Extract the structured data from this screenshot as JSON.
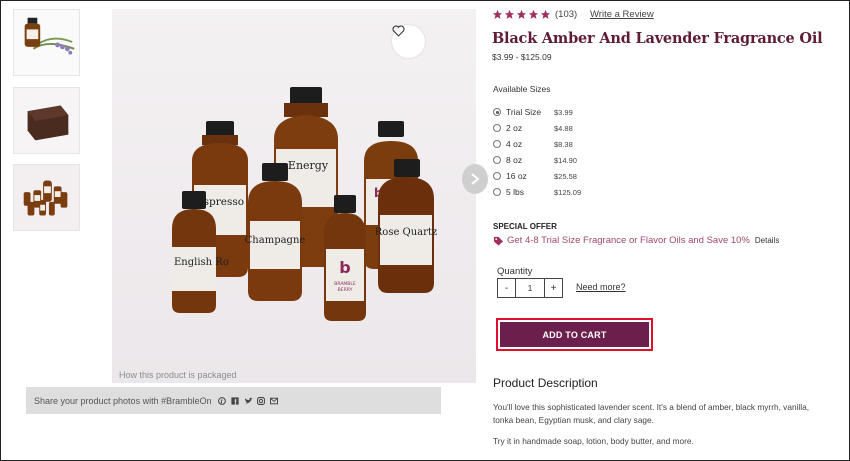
{
  "gallery": {
    "thumbnails": [
      {
        "icon": "lavender-bottle-thumbnail"
      },
      {
        "icon": "soap-bar-thumbnail"
      },
      {
        "icon": "bottle-group-thumbnail"
      }
    ],
    "main_caption": "How this product is packaged",
    "bottle_labels": [
      "Espresso",
      "Energy",
      "Champagne",
      "English Ro",
      "Rose Quartz"
    ],
    "brand_word_1": "BRAMBLE",
    "brand_word_2": "BERRY",
    "share_text": "Share your product photos with #BrambleOn",
    "share_icons": [
      "pinterest-icon",
      "facebook-icon",
      "twitter-icon",
      "instagram-icon",
      "email-icon"
    ]
  },
  "product": {
    "rating_count": "(103)",
    "write_review": "Write a Review",
    "title": "Black Amber And Lavender Fragrance Oil",
    "price_range": "$3.99 - $125.09",
    "available_sizes_label": "Available Sizes",
    "sizes": [
      {
        "name": "Trial Size",
        "price": "$3.99"
      },
      {
        "name": "2 oz",
        "price": "$4.88"
      },
      {
        "name": "4 oz",
        "price": "$8.38"
      },
      {
        "name": "8 oz",
        "price": "$14.90"
      },
      {
        "name": "16 oz",
        "price": "$25.58"
      },
      {
        "name": "5 lbs",
        "price": "$125.09"
      }
    ],
    "special_offer_label": "SPECIAL OFFER",
    "offer_text": "Get 4-8 Trial Size Fragrance or Flavor Oils and Save 10%",
    "offer_details": "Details",
    "quantity_label": "Quantity",
    "quantity_minus": "-",
    "quantity_value": "1",
    "quantity_plus": "+",
    "need_more": "Need more?",
    "add_to_cart": "ADD TO CART",
    "description_title": "Product Description",
    "description_1": "You'll love this sophisticated lavender scent. It's a blend of amber, black myrrh, vanilla, tonka bean, Egyptian musk, and clary sage.",
    "description_2": "Try it in handmade soap, lotion, body butter, and more."
  },
  "colors": {
    "brand_plum": "#6c1f4c",
    "title_plum": "#5e1c36",
    "offer_pink": "#a24a6f",
    "star_color": "#a2305f",
    "highlight_red": "#e0102a"
  }
}
